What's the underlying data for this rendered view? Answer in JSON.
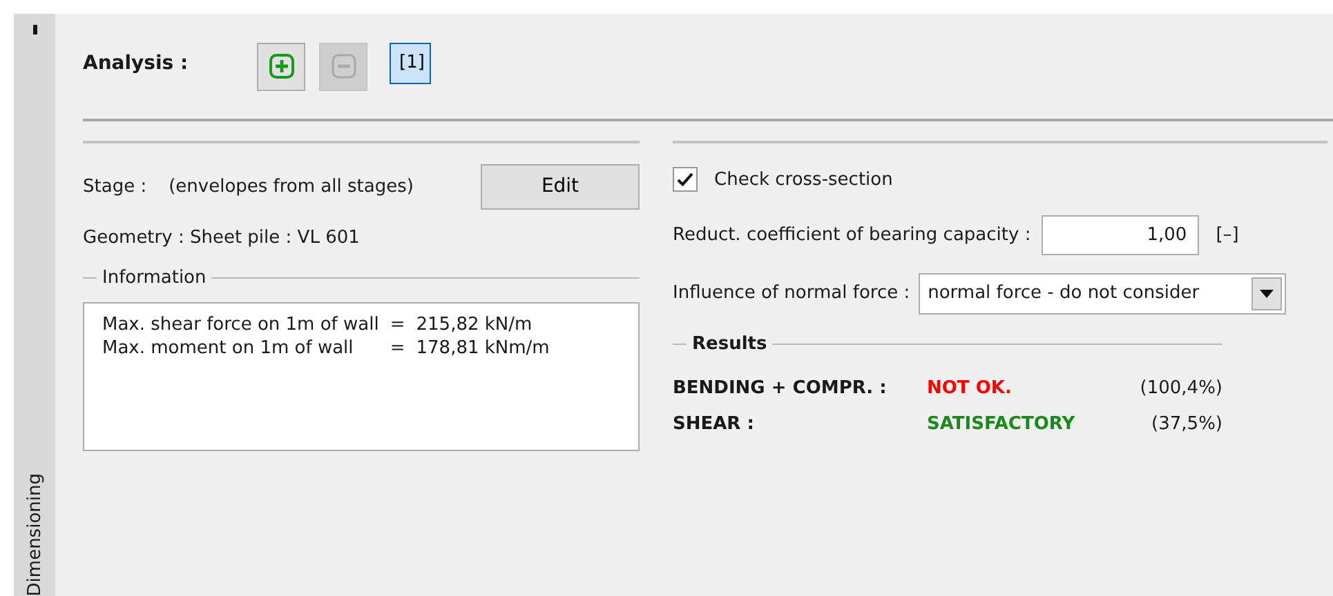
{
  "side_tab": {
    "label": "Dimensioning"
  },
  "analysis": {
    "label": "Analysis :",
    "buttons": [
      {
        "kind": "add",
        "disabled": false,
        "selected": false
      },
      {
        "kind": "remove",
        "disabled": true,
        "selected": false
      },
      {
        "kind": "stage",
        "label": "[1]",
        "disabled": false,
        "selected": true
      }
    ]
  },
  "stage": {
    "label": "Stage :",
    "value": "(envelopes from all stages)",
    "button": "Edit"
  },
  "geometry": "Geometry : Sheet pile : VL 601",
  "information": {
    "title": "Information",
    "lines": [
      {
        "label": "Max. shear force on 1m of wall",
        "sign": "=",
        "value": "215,82 kN/m"
      },
      {
        "label": "Max. moment on 1m of wall",
        "sign": "=",
        "value": "178,81 kNm/m"
      }
    ]
  },
  "check": {
    "label": "Check cross-section",
    "checked": true
  },
  "reduction": {
    "label": "Reduct. coefficient of bearing capacity :",
    "value": "1,00",
    "unit": "[–]"
  },
  "normal_force": {
    "label": "Influence of normal force :",
    "value": "normal force - do not consider"
  },
  "results": {
    "title": "Results",
    "rows": [
      {
        "label": "BENDING + COMPR. :",
        "status": "NOT OK.",
        "kind": "fail",
        "percent": "(100,4%)"
      },
      {
        "label": "SHEAR :",
        "status": "SATISFACTORY",
        "kind": "ok",
        "percent": "(37,5%)"
      }
    ]
  }
}
